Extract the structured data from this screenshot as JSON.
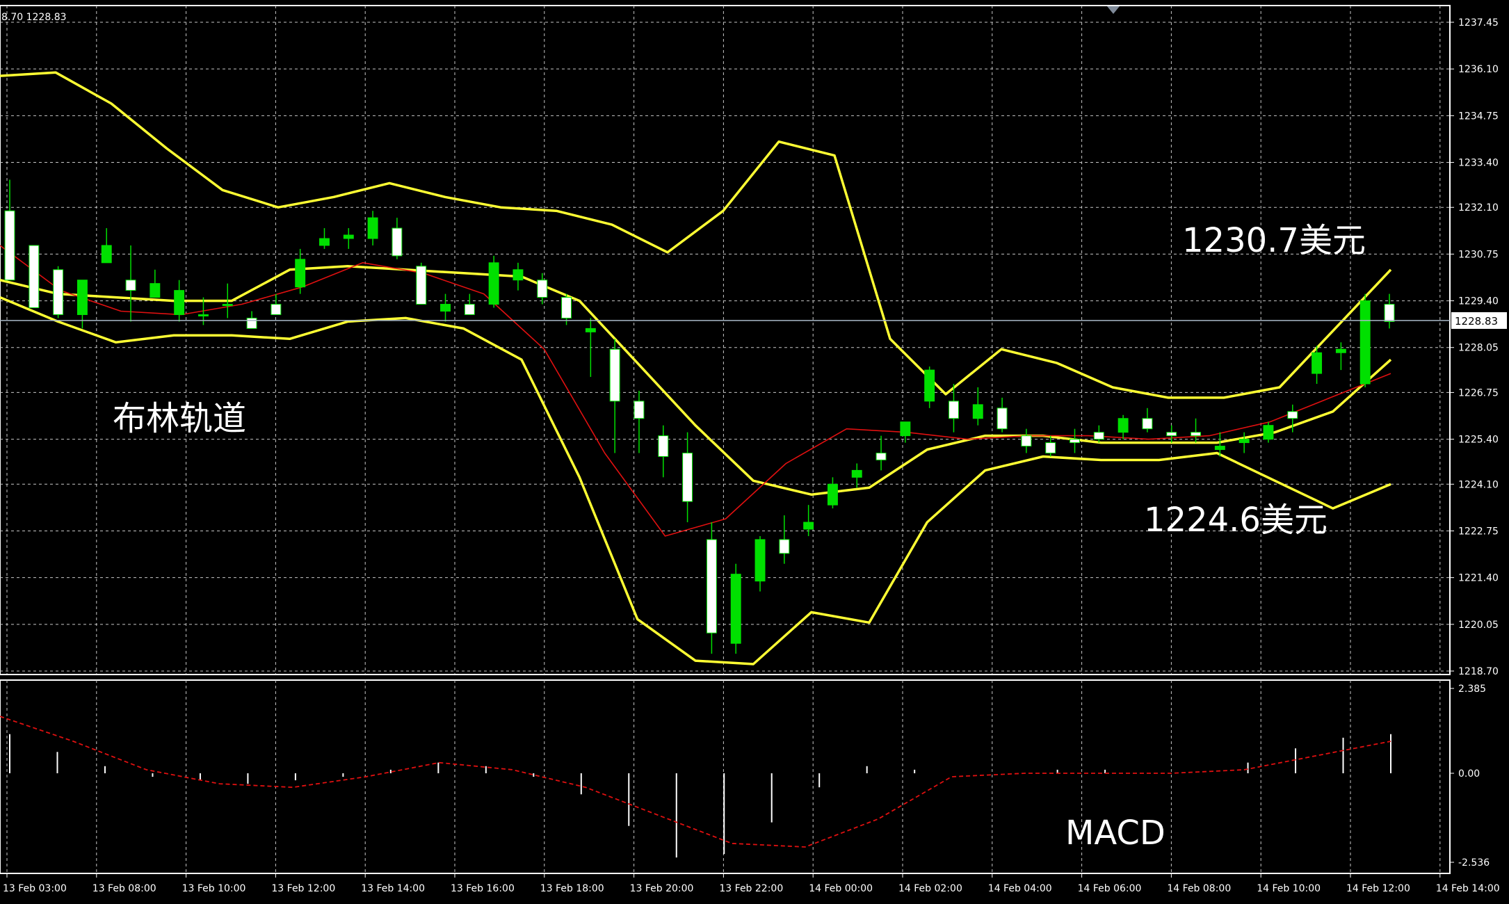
{
  "header": {
    "ohlc_text": "8.70 1228.83"
  },
  "colors": {
    "background": "#000000",
    "grid": "#c8c8c8",
    "frame": "#ffffff",
    "bull_candle": "#00e000",
    "bear_candle": "#ffffff",
    "bollinger": "#ffff33",
    "red_ma": "#e01010",
    "macd_hist": "#ffffff",
    "macd_signal": "#e01010",
    "current_price_line": "#a8b8c8"
  },
  "price_panel": {
    "current_price": 1228.83,
    "current_price_label": "1228.83",
    "y_ticks": [
      "1237.45",
      "1236.10",
      "1234.75",
      "1233.40",
      "1232.10",
      "1230.75",
      "1229.40",
      "1228.05",
      "1226.75",
      "1225.40",
      "1224.10",
      "1222.75",
      "1221.40",
      "1220.05",
      "1218.70"
    ]
  },
  "macd_panel": {
    "y_ticks": [
      "2.385",
      "0.00",
      "-2.536"
    ]
  },
  "x_ticks": [
    "13 Feb 03:00",
    "13 Feb 08:00",
    "13 Feb 10:00",
    "13 Feb 12:00",
    "13 Feb 14:00",
    "13 Feb 16:00",
    "13 Feb 18:00",
    "13 Feb 20:00",
    "13 Feb 22:00",
    "14 Feb 00:00",
    "14 Feb 02:00",
    "14 Feb 04:00",
    "14 Feb 06:00",
    "14 Feb 08:00",
    "14 Feb 10:00",
    "14 Feb 12:00",
    "14 Feb 14:00"
  ],
  "annotations": {
    "bollinger_label": "布林轨道",
    "upper_price": "1230.7美元",
    "lower_price": "1224.6美元",
    "macd_label": "MACD"
  },
  "chart_data": {
    "type": "line",
    "series": [
      {
        "key": "upper",
        "values": [
          1235.9,
          1236.0,
          1235.1,
          1233.8,
          1232.6,
          1232.1,
          1232.4,
          1232.8,
          1232.4,
          1232.1,
          1232.0,
          1231.6,
          1230.8,
          1232.0,
          1234.0,
          1233.6,
          1228.3,
          1226.7,
          1228.0,
          1227.6,
          1226.9,
          1226.6,
          1226.6,
          1226.9,
          1228.6,
          1230.3
        ]
      },
      {
        "key": "middle",
        "values": [
          1230.0,
          1229.6,
          1229.5,
          1229.4,
          1229.4,
          1230.3,
          1230.4,
          1230.3,
          1230.2,
          1230.1,
          1229.4,
          1227.6,
          1225.8,
          1224.2,
          1223.8,
          1224.0,
          1225.1,
          1225.5,
          1225.5,
          1225.3,
          1225.3,
          1225.3,
          1225.6,
          1226.2,
          1227.7
        ]
      },
      {
        "key": "lower",
        "values": [
          1229.5,
          1228.8,
          1228.2,
          1228.4,
          1228.4,
          1228.3,
          1228.8,
          1228.9,
          1228.6,
          1227.7,
          1224.3,
          1220.2,
          1219.0,
          1218.9,
          1220.4,
          1220.1,
          1223.0,
          1224.5,
          1224.9,
          1224.8,
          1224.8,
          1225.0,
          1224.2,
          1223.4,
          1224.1
        ]
      },
      {
        "key": "red",
        "values": [
          1231.0,
          1229.7,
          1229.1,
          1229.0,
          1229.3,
          1229.8,
          1230.5,
          1230.2,
          1229.6,
          1228.0,
          1225.0,
          1222.6,
          1223.1,
          1224.7,
          1225.7,
          1225.6,
          1225.4,
          1225.5,
          1225.5,
          1225.4,
          1225.5,
          1225.9,
          1226.6,
          1227.3
        ]
      },
      {
        "key": "macd_signal",
        "values": [
          1.6,
          0.9,
          0.1,
          -0.3,
          -0.4,
          -0.1,
          0.3,
          0.1,
          -0.4,
          -1.2,
          -2.0,
          -2.1,
          -1.3,
          -0.1,
          0.0,
          0.0,
          0.0,
          0.1,
          0.5,
          0.9
        ]
      }
    ],
    "candles": [
      [
        1232.0,
        1232.9,
        1232.0,
        1230.0
      ],
      [
        1231.0,
        1231.0,
        1230.8,
        1229.2
      ],
      [
        1230.3,
        1230.4,
        1228.9,
        1229.0
      ],
      [
        1229.0,
        1229.2,
        1228.6,
        1230.0
      ],
      [
        1230.5,
        1231.5,
        1230.5,
        1231.0
      ],
      [
        1230.0,
        1231.0,
        1228.8,
        1229.7
      ],
      [
        1229.5,
        1230.3,
        1229.5,
        1229.9
      ],
      [
        1229.0,
        1230.0,
        1228.8,
        1229.7
      ],
      [
        1229.0,
        1229.5,
        1228.7,
        1229.0
      ],
      [
        1229.3,
        1229.9,
        1228.9,
        1229.3
      ],
      [
        1228.9,
        1229.1,
        1228.6,
        1228.6
      ],
      [
        1229.3,
        1229.6,
        1229.0,
        1229.0
      ],
      [
        1229.8,
        1230.9,
        1229.6,
        1230.6
      ],
      [
        1231.0,
        1231.5,
        1230.9,
        1231.2
      ],
      [
        1231.2,
        1231.5,
        1230.9,
        1231.3
      ],
      [
        1231.2,
        1232.0,
        1231.0,
        1231.8
      ],
      [
        1231.5,
        1231.8,
        1230.6,
        1230.7
      ],
      [
        1230.4,
        1230.5,
        1229.3,
        1229.3
      ],
      [
        1229.1,
        1229.6,
        1228.8,
        1229.3
      ],
      [
        1229.3,
        1229.6,
        1229.0,
        1229.0
      ],
      [
        1229.3,
        1230.7,
        1229.2,
        1230.5
      ],
      [
        1230.0,
        1230.5,
        1229.7,
        1230.3
      ],
      [
        1230.0,
        1230.2,
        1229.3,
        1229.5
      ],
      [
        1229.5,
        1229.6,
        1228.7,
        1228.9
      ],
      [
        1228.5,
        1228.9,
        1227.2,
        1228.6
      ],
      [
        1228.0,
        1228.3,
        1225.0,
        1226.5
      ],
      [
        1226.5,
        1226.8,
        1225.0,
        1226.0
      ],
      [
        1225.5,
        1225.8,
        1224.3,
        1224.9
      ],
      [
        1225.0,
        1225.6,
        1223.0,
        1223.6
      ],
      [
        1222.5,
        1223.0,
        1219.2,
        1219.8
      ],
      [
        1219.5,
        1221.8,
        1219.2,
        1221.5
      ],
      [
        1221.3,
        1222.6,
        1221.0,
        1222.5
      ],
      [
        1222.5,
        1223.2,
        1221.8,
        1222.1
      ],
      [
        1222.8,
        1223.5,
        1222.6,
        1223.0
      ],
      [
        1223.5,
        1224.3,
        1223.4,
        1224.1
      ],
      [
        1224.3,
        1224.7,
        1224.0,
        1224.5
      ],
      [
        1225.0,
        1225.5,
        1224.5,
        1224.8
      ],
      [
        1225.5,
        1225.8,
        1225.3,
        1225.9
      ],
      [
        1226.5,
        1227.5,
        1226.3,
        1227.4
      ],
      [
        1226.5,
        1227.0,
        1225.6,
        1226.0
      ],
      [
        1226.0,
        1226.9,
        1225.8,
        1226.4
      ],
      [
        1226.3,
        1226.6,
        1225.6,
        1225.7
      ],
      [
        1225.5,
        1225.7,
        1225.0,
        1225.2
      ],
      [
        1225.3,
        1225.5,
        1224.9,
        1225.0
      ],
      [
        1225.4,
        1225.7,
        1225.0,
        1225.3
      ],
      [
        1225.6,
        1225.8,
        1225.3,
        1225.4
      ],
      [
        1225.6,
        1226.1,
        1225.4,
        1226.0
      ],
      [
        1226.0,
        1226.3,
        1225.6,
        1225.7
      ],
      [
        1225.6,
        1225.8,
        1225.3,
        1225.5
      ],
      [
        1225.6,
        1226.0,
        1225.3,
        1225.5
      ],
      [
        1225.1,
        1225.6,
        1224.9,
        1225.2
      ],
      [
        1225.3,
        1225.6,
        1225.0,
        1225.4
      ],
      [
        1225.4,
        1225.9,
        1225.3,
        1225.8
      ],
      [
        1226.2,
        1226.4,
        1225.6,
        1226.0
      ],
      [
        1227.3,
        1228.1,
        1227.0,
        1227.9
      ],
      [
        1227.9,
        1228.2,
        1227.4,
        1228.0
      ],
      [
        1227.0,
        1229.6,
        1226.9,
        1229.4
      ],
      [
        1229.3,
        1229.6,
        1228.6,
        1228.8
      ]
    ],
    "macd_histogram": [
      1.1,
      0.6,
      0.2,
      -0.1,
      -0.2,
      -0.3,
      -0.2,
      -0.1,
      0.1,
      0.3,
      0.2,
      -0.1,
      -0.6,
      -1.5,
      -2.4,
      -2.3,
      -1.4,
      -0.4,
      0.2,
      0.1,
      0.0,
      0.0,
      0.1,
      0.1,
      0.0,
      0.0,
      0.3,
      0.7,
      1.0,
      1.1
    ],
    "y_range_price": [
      1218.7,
      1237.45
    ],
    "y_range_macd": [
      -2.536,
      2.385
    ],
    "grid": true
  }
}
